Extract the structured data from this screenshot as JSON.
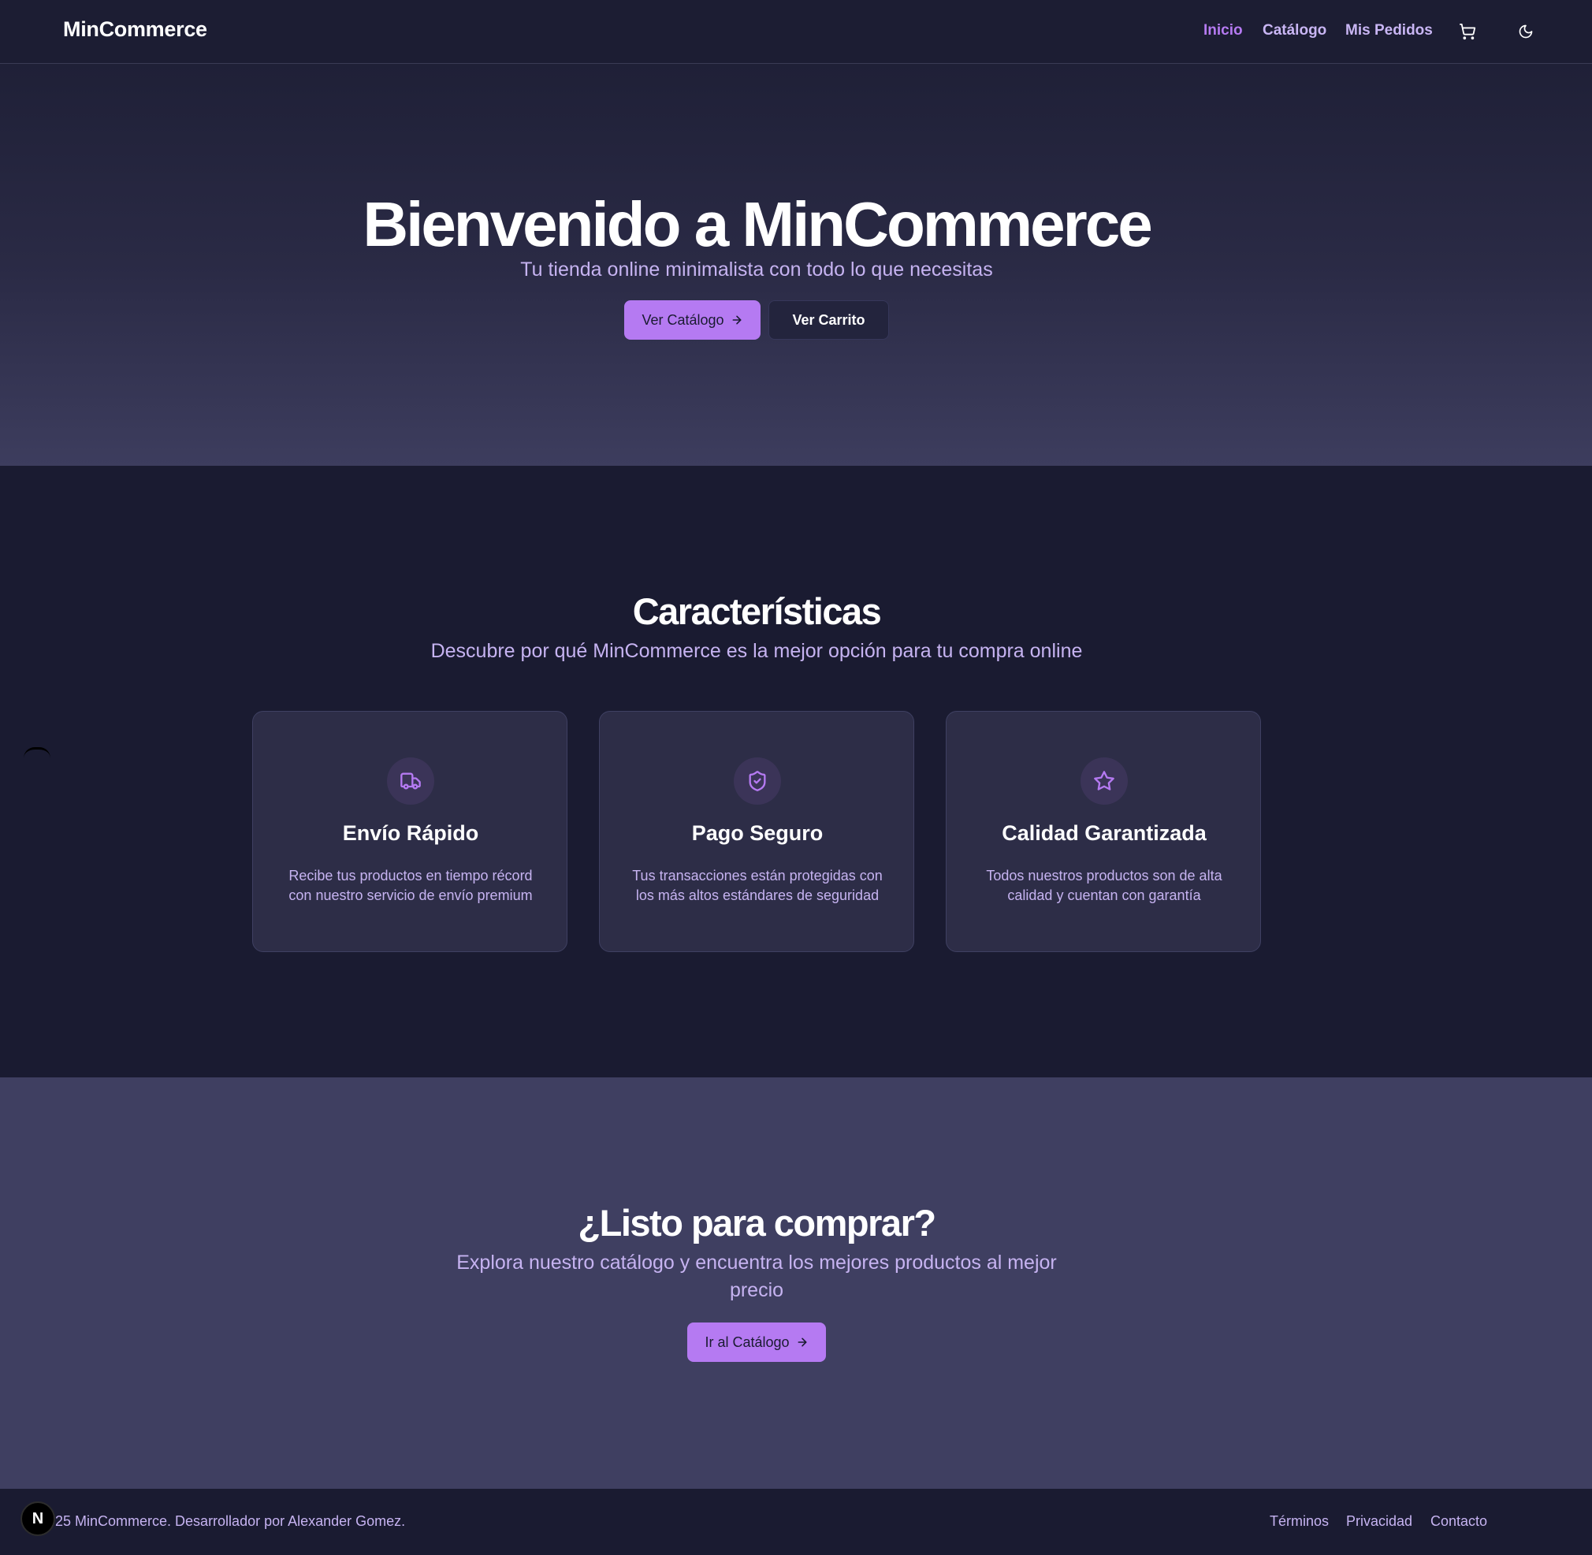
{
  "header": {
    "brand": "MinCommerce",
    "nav": [
      {
        "label": "Inicio",
        "active": true
      },
      {
        "label": "Catálogo",
        "active": false
      },
      {
        "label": "Mis Pedidos",
        "active": false
      }
    ],
    "icons": [
      "cart-icon",
      "moon-icon"
    ]
  },
  "hero": {
    "title": "Bienvenido a MinCommerce",
    "subtitle": "Tu tienda online minimalista con todo lo que necesitas",
    "primary_button": "Ver Catálogo",
    "secondary_button": "Ver Carrito"
  },
  "features": {
    "title": "Características",
    "subtitle": "Descubre por qué MinCommerce es la mejor opción para tu compra online",
    "cards": [
      {
        "icon": "truck-icon",
        "title": "Envío Rápido",
        "description": "Recibe tus productos en tiempo récord con nuestro servicio de envío premium"
      },
      {
        "icon": "shield-check-icon",
        "title": "Pago Seguro",
        "description": "Tus transacciones están protegidas con los más altos estándares de seguridad"
      },
      {
        "icon": "star-icon",
        "title": "Calidad Garantizada",
        "description": "Todos nuestros productos son de alta calidad y cuentan con garantía"
      }
    ]
  },
  "cta": {
    "title": "¿Listo para comprar?",
    "subtitle": "Explora nuestro catálogo y encuentra los mejores productos al mejor precio",
    "button": "Ir al Catálogo"
  },
  "footer": {
    "copyright": "25 MinCommerce. Desarrollador por Alexander Gomez.",
    "links": [
      "Términos",
      "Privacidad",
      "Contacto"
    ],
    "dev_badge": "N"
  },
  "colors": {
    "accent": "#b57af2",
    "text_muted": "#c6b3f1",
    "background": "#1a1b31",
    "card": "#2d2d47",
    "cta_background": "#3f3f61"
  }
}
